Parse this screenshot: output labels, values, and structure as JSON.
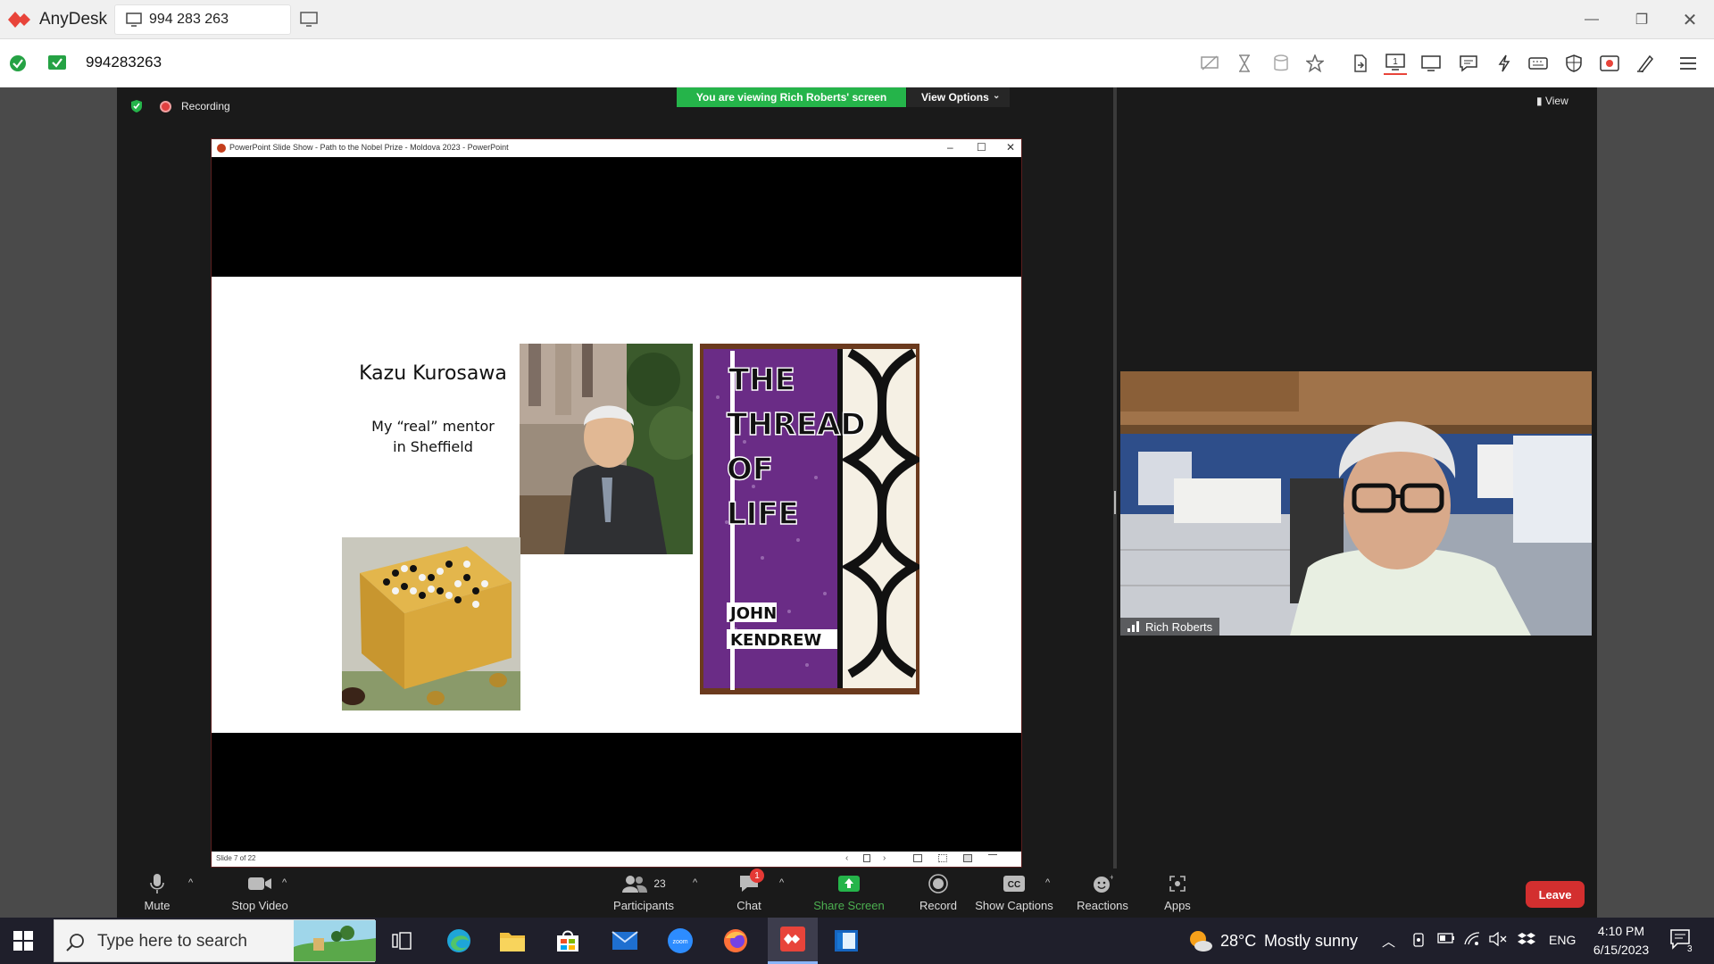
{
  "anydesk": {
    "app_name": "AnyDesk",
    "tab_label": "994 283 263",
    "address": "994283263",
    "accent": "#e8443a"
  },
  "zoom": {
    "recording_label": "Recording",
    "viewing_banner": "You are viewing Rich Roberts' screen",
    "view_options_label": "View Options",
    "view_label": "View",
    "participant_name": "Rich Roberts",
    "toolbar": {
      "mute": "Mute",
      "stop_video": "Stop Video",
      "participants": "Participants",
      "participants_count": "23",
      "chat": "Chat",
      "chat_badge": "1",
      "share_screen": "Share Screen",
      "record": "Record",
      "show_captions": "Show Captions",
      "reactions": "Reactions",
      "apps": "Apps",
      "leave": "Leave"
    },
    "share_green": "#25b44a",
    "leave_red": "#d32f2f"
  },
  "powerpoint": {
    "window_title": "PowerPoint Slide Show - Path to the Nobel Prize - Moldova 2023 - PowerPoint",
    "status": "Slide 7 of 22",
    "slide": {
      "heading": "Kazu Kurosawa",
      "subtitle_line1": "My “real” mentor",
      "subtitle_line2": "in Sheffield",
      "book_title_lines": [
        "THE",
        "THREAD",
        "OF",
        "LIFE"
      ],
      "book_author_lines": [
        "JOHN",
        "KENDREW"
      ]
    }
  },
  "taskbar": {
    "search_placeholder": "Type here to search",
    "weather_temp": "28°C",
    "weather_desc": "Mostly sunny",
    "language": "ENG",
    "time": "4:10 PM",
    "date": "6/15/2023",
    "notification_count": "3"
  }
}
